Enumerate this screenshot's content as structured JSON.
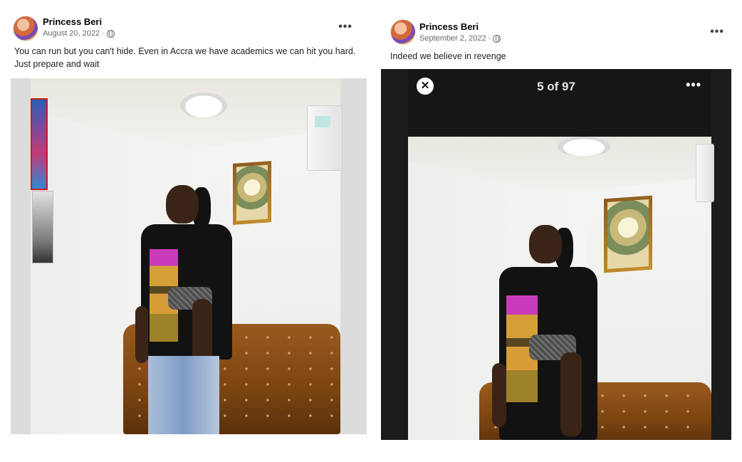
{
  "posts": [
    {
      "author": "Princess Beri",
      "date": "August 20, 2022",
      "text": "You can run but you can't hide. Even in Accra we have academics we can hit you hard. Just prepare and wait",
      "more_icon": "ellipsis-icon",
      "privacy_icon": "globe-icon"
    },
    {
      "author": "Princess Beri",
      "date": "September 2, 2022",
      "text": "Indeed we believe in revenge",
      "more_icon": "ellipsis-icon",
      "privacy_icon": "globe-icon",
      "viewer": {
        "close_icon": "close-icon",
        "counter": "5 of 97",
        "more_icon": "ellipsis-icon"
      }
    }
  ]
}
